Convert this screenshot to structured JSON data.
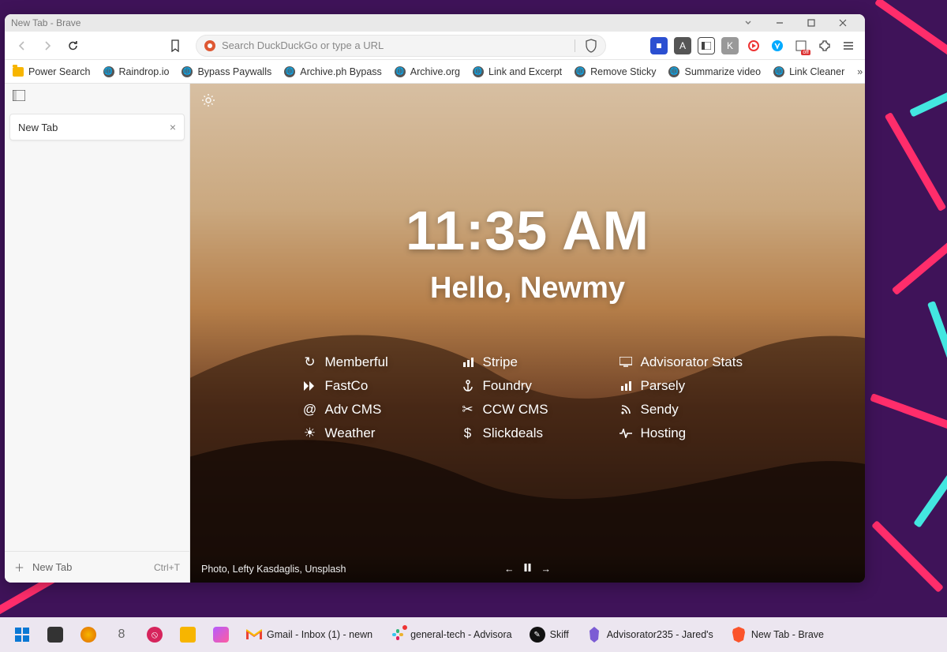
{
  "window": {
    "title": "New Tab - Brave"
  },
  "omnibox": {
    "placeholder": "Search DuckDuckGo or type a URL"
  },
  "bookmarks": {
    "items": [
      "Power Search",
      "Raindrop.io",
      "Bypass Paywalls",
      "Archive.ph Bypass",
      "Archive.org",
      "Link and Excerpt",
      "Remove Sticky",
      "Summarize video",
      "Link Cleaner"
    ]
  },
  "sidebar": {
    "tab_label": "New Tab",
    "new_tab_label": "New Tab",
    "new_tab_shortcut": "Ctrl+T"
  },
  "newtab": {
    "clock": "11:35 AM",
    "greeting": "Hello, Newmy",
    "credit": "Photo, Lefty Kasdaglis, Unsplash",
    "links": {
      "c0": [
        "Memberful",
        "FastCo",
        "Adv CMS",
        "Weather"
      ],
      "c1": [
        "Stripe",
        "Foundry",
        "CCW CMS",
        "Slickdeals"
      ],
      "c2": [
        "Advisorator Stats",
        "Parsely",
        "Sendy",
        "Hosting"
      ]
    }
  },
  "taskbar": {
    "items": [
      "Gmail - Inbox (1) - newn",
      "general-tech - Advisora",
      "Skiff",
      "Advisorator235 - Jared's",
      "New Tab - Brave"
    ]
  }
}
